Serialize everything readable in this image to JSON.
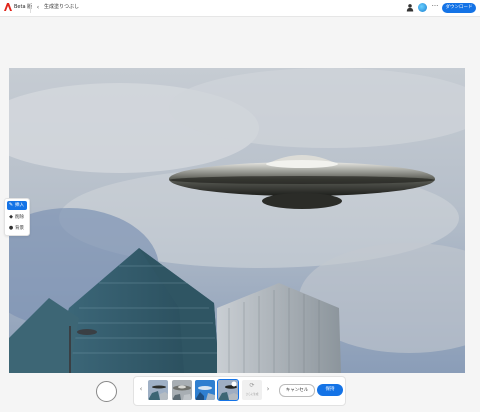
{
  "header": {
    "app_name": "Beta 版",
    "page_title": "生成塗りつぶし",
    "back_icon": "‹",
    "more_icon": "···",
    "download_label": "ダウンロード"
  },
  "side_toolbar": {
    "items": [
      {
        "label": "挿入",
        "icon": "insert-icon"
      },
      {
        "label": "削除",
        "icon": "eraser-icon"
      },
      {
        "label": "背景",
        "icon": "background-icon"
      }
    ]
  },
  "variants": {
    "prev_icon": "‹",
    "next_icon": "›",
    "more_label": "さらに生成",
    "more_icon": "⟳"
  },
  "actions": {
    "cancel_label": "キャンセル",
    "keep_label": "保持"
  },
  "colors": {
    "accent": "#1473e6"
  }
}
